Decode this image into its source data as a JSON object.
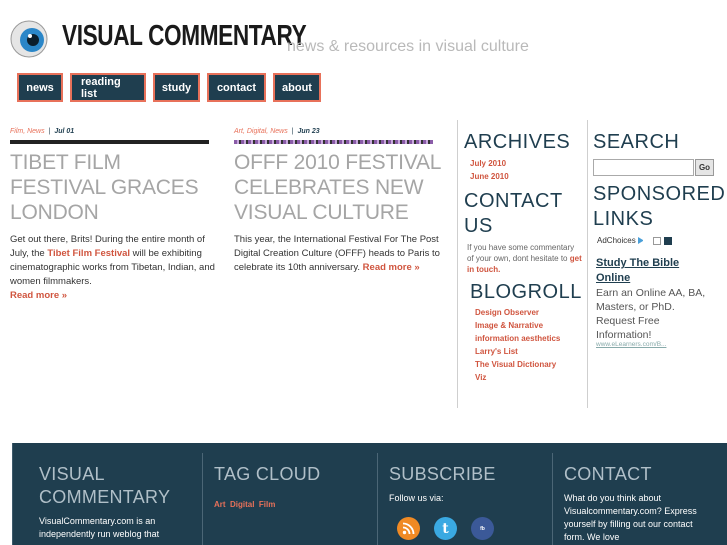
{
  "site": {
    "title": "VISUAL COMMENTARY",
    "tagline": "news & resources in visual culture"
  },
  "nav": [
    {
      "label": "news"
    },
    {
      "label": "reading list"
    },
    {
      "label": "study"
    },
    {
      "label": "contact"
    },
    {
      "label": "about"
    }
  ],
  "posts": [
    {
      "categories": [
        "Film",
        "News"
      ],
      "date": "Jul 01",
      "title": "TIBET FILM FESTIVAL GRACES LONDON",
      "body_before": "Get out there, Brits! During the entire month of July, the ",
      "body_link": "Tibet Film Festival",
      "body_after": " will be exhibiting cinematographic works from Tibetan, Indian, and women filmmakers.",
      "read_more": "Read more »"
    },
    {
      "categories": [
        "Art",
        "Digital",
        "News"
      ],
      "date": "Jun 23",
      "title": "OFFF 2010 FESTIVAL CELEBRATES NEW VISUAL CULTURE",
      "body_before": "This year, the International Festival For The Post Digital Creation Culture (OFFF) heads to Paris to celebrate its 10th anniversary. ",
      "body_link": "",
      "body_after": "",
      "read_more": "Read more »"
    }
  ],
  "archives": {
    "heading": "ARCHIVES",
    "items": [
      "July 2010",
      "June 2010"
    ]
  },
  "contact_side": {
    "heading": "CONTACT US",
    "text": "If you have some commentary of your own, dont hesitate to ",
    "link": "get in touch."
  },
  "blogroll": {
    "heading": "BLOGROLL",
    "items": [
      "Design Observer",
      "Image & Narrative",
      "information aesthetics",
      "Larry's List",
      "The Visual Dictionary",
      "Viz"
    ]
  },
  "search": {
    "heading": "SEARCH",
    "value": "",
    "button": "Go"
  },
  "sponsored": {
    "heading": "SPONSORED LINKS",
    "adchoices": "AdChoices",
    "ad_title": "Study The Bible Online",
    "ad_text": "Earn an Online AA, BA, Masters, or PhD. Request Free Information!",
    "ad_url": "www.eLearners.com/B..."
  },
  "footer": {
    "about_heading": "VISUAL COMMENTARY",
    "about_text": "VisualCommentary.com is an independently run weblog that",
    "tag_heading": "TAG CLOUD",
    "tags": [
      "Art",
      "Digital",
      "Film"
    ],
    "subscribe_heading": "SUBSCRIBE",
    "subscribe_text": "Follow us via:",
    "social": [
      "rss-icon",
      "twitter-icon",
      "facebook-icon"
    ],
    "contact_heading": "CONTACT",
    "contact_text": "What do you think about Visualcommentary.com? Express yourself by filling out our contact form. We love"
  },
  "colors": {
    "navy": "#1f3e4f",
    "accent": "#e8715a",
    "link": "#d0553f"
  }
}
